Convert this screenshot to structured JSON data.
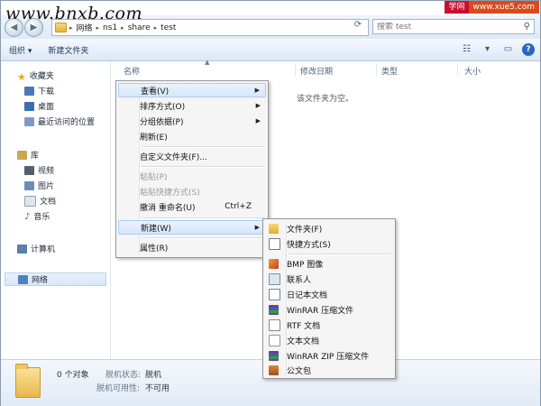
{
  "watermark": {
    "left": "www.bnxb.com",
    "right_a": "学网",
    "right_b": "www.xue5.com"
  },
  "address": {
    "crumbs": [
      "网络",
      "ns1",
      "share",
      "test"
    ]
  },
  "search": {
    "placeholder": "搜索 test"
  },
  "toolbar": {
    "organize": "组织 ▾",
    "new_folder": "新建文件夹"
  },
  "nav": {
    "favorites": "收藏夹",
    "downloads": "下载",
    "desktop": "桌面",
    "recent": "最近访问的位置",
    "libraries": "库",
    "videos": "视频",
    "pictures": "图片",
    "documents": "文档",
    "music": "音乐",
    "computer": "计算机",
    "network": "网络"
  },
  "columns": {
    "name": "名称",
    "date": "修改日期",
    "type": "类型",
    "size": "大小"
  },
  "empty_message": "该文件夹为空。",
  "status": {
    "count": "0 个对象",
    "offline_state_label": "脱机状态:",
    "offline_state_value": "脱机",
    "offline_avail_label": "脱机可用性:",
    "offline_avail_value": "不可用"
  },
  "context_menu": {
    "view": "查看(V)",
    "sort": "排序方式(O)",
    "group": "分组依据(P)",
    "refresh": "刷新(E)",
    "customize": "自定义文件夹(F)...",
    "paste": "粘贴(P)",
    "paste_shortcut": "粘贴快捷方式(S)",
    "undo": "撤消 重命名(U)",
    "undo_shortcut": "Ctrl+Z",
    "new": "新建(W)",
    "properties": "属性(R)"
  },
  "submenu": {
    "folder": "文件夹(F)",
    "shortcut": "快捷方式(S)",
    "bmp": "BMP 图像",
    "contact": "联系人",
    "journal": "日记本文档",
    "winrar": "WinRAR 压缩文件",
    "rtf": "RTF 文档",
    "text": "文本文档",
    "winrar_zip": "WinRAR ZIP 压缩文件",
    "briefcase": "公文包"
  },
  "colors": {
    "accent": "#3e6ea8",
    "menu_bg": "#f5f5f5",
    "highlight": "#d5e6fa"
  }
}
